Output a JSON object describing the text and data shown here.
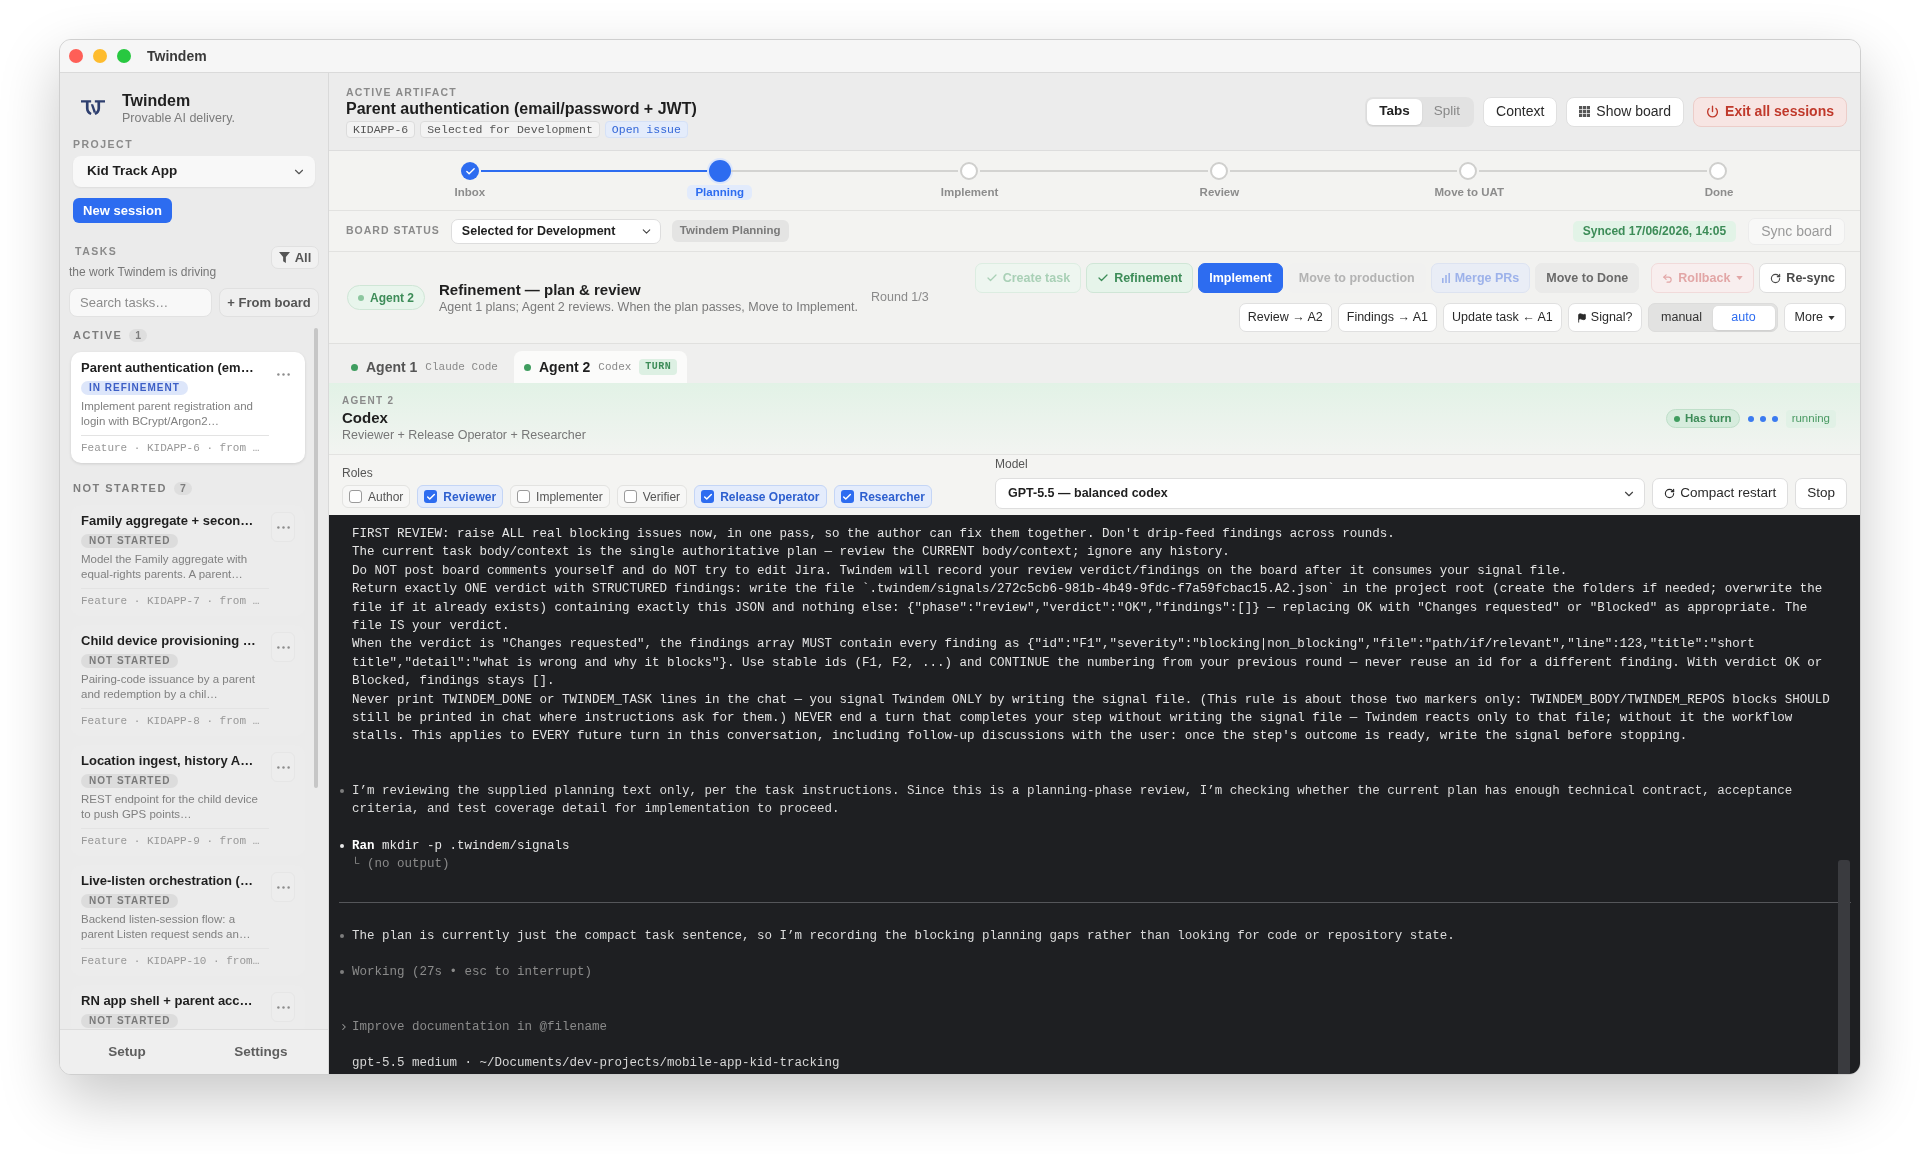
{
  "window": {
    "title": "Twindem"
  },
  "sidebar": {
    "brand": {
      "name": "Twindem",
      "tagline": "Provable AI delivery."
    },
    "project": {
      "label": "PROJECT",
      "value": "Kid Track App"
    },
    "new_session_button": "New session",
    "tasks": {
      "label": "TASKS",
      "subtitle": "the work Twindem is driving",
      "filter": "All",
      "search_placeholder": "Search tasks…",
      "from_board_button": "+ From board"
    },
    "groups": [
      {
        "label": "ACTIVE",
        "count": "1",
        "tasks": [
          {
            "title": "Parent authentication (em…",
            "status": "IN REFINEMENT",
            "kind": "refinement",
            "description": "Implement parent registration and login with BCrypt/Argon2…",
            "meta": "Feature · KIDAPP-6 · from …",
            "selected": true
          }
        ]
      },
      {
        "label": "NOT STARTED",
        "count": "7",
        "tasks": [
          {
            "title": "Family aggregate + secon…",
            "status": "NOT STARTED",
            "kind": "not_started",
            "description": "Model the Family aggregate with equal-rights parents. A parent…",
            "meta": "Feature · KIDAPP-7 · from …",
            "selected": false
          },
          {
            "title": "Child device provisioning …",
            "status": "NOT STARTED",
            "kind": "not_started",
            "description": "Pairing-code issuance by a parent and redemption by a chil…",
            "meta": "Feature · KIDAPP-8 · from …",
            "selected": false
          },
          {
            "title": "Location ingest, history A…",
            "status": "NOT STARTED",
            "kind": "not_started",
            "description": "REST endpoint for the child device to push GPS points…",
            "meta": "Feature · KIDAPP-9 · from …",
            "selected": false
          },
          {
            "title": "Live-listen orchestration (…",
            "status": "NOT STARTED",
            "kind": "not_started",
            "description": "Backend listen-session flow: a parent Listen request sends an…",
            "meta": "Feature · KIDAPP-10 · from…",
            "selected": false
          },
          {
            "title": "RN app shell + parent acc…",
            "status": "NOT STARTED",
            "kind": "not_started",
            "selected": false
          }
        ]
      }
    ],
    "footer": [
      "Setup",
      "Settings"
    ]
  },
  "artifact": {
    "label": "ACTIVE ARTIFACT",
    "title": "Parent authentication (email/password + JWT)",
    "tags": [
      {
        "text": "KIDAPP-6",
        "kind": "key"
      },
      {
        "text": "Selected for Development",
        "kind": "status"
      },
      {
        "text": "Open issue",
        "kind": "link"
      }
    ]
  },
  "view_modes": [
    {
      "label": "Tabs",
      "selected": true
    },
    {
      "label": "Split",
      "selected": false
    }
  ],
  "header_actions": [
    {
      "label": "Context",
      "kind": "plain"
    },
    {
      "label": "Show board",
      "kind": "board"
    },
    {
      "label": "Exit all sessions",
      "kind": "exit"
    }
  ],
  "stepper": [
    {
      "label": "Inbox",
      "completed": true,
      "selected": false
    },
    {
      "label": "Planning",
      "completed": false,
      "selected": true
    },
    {
      "label": "Implement",
      "completed": false,
      "selected": false
    },
    {
      "label": "Review",
      "completed": false,
      "selected": false
    },
    {
      "label": "Move to UAT",
      "completed": false,
      "selected": false
    },
    {
      "label": "Done",
      "completed": false,
      "selected": false
    }
  ],
  "board_status": {
    "label": "BOARD STATUS",
    "value": "Selected for Development",
    "tag": "Twindem Planning",
    "synced": "Synced 17/06/2026, 14:05",
    "sync_button": "Sync board"
  },
  "phase": {
    "agent": "Agent 2",
    "title": "Refinement — plan & review",
    "subtitle": "Agent 1 plans; Agent 2 reviews. When the plan passes, Move to Implement.",
    "round": "Round 1/3"
  },
  "phase_actions": [
    {
      "label": "Create task",
      "kind": "completed",
      "disabled": true
    },
    {
      "label": "Refinement",
      "kind": "completed",
      "disabled": false
    },
    {
      "label": "Implement",
      "kind": "primary",
      "disabled": false
    },
    {
      "label": "Move to production",
      "kind": "plain",
      "disabled": true
    },
    {
      "label": "Merge PRs",
      "kind": "merge",
      "disabled": true
    },
    {
      "label": "Move to Done",
      "kind": "plain",
      "disabled": false
    },
    {
      "label": "Rollback",
      "kind": "rollback",
      "disabled": true
    },
    {
      "label": "Re-sync",
      "kind": "resync",
      "disabled": false
    }
  ],
  "handoff_actions": [
    {
      "label": "Review → A2",
      "kind": "plain"
    },
    {
      "label": "Findings → A1",
      "kind": "plain"
    },
    {
      "label": "Update task ← A1",
      "kind": "plain"
    },
    {
      "label": "Signal?",
      "kind": "signal"
    }
  ],
  "mode_toggle": [
    {
      "label": "manual",
      "selected": false
    },
    {
      "label": "auto",
      "selected": true
    }
  ],
  "more_button": "More",
  "agent_tabs": [
    {
      "name": "Agent 1",
      "tool": "Claude Code",
      "selected": false
    },
    {
      "name": "Agent 2",
      "tool": "Codex",
      "badge": "TURN",
      "selected": true
    }
  ],
  "agent": {
    "label": "AGENT 2",
    "name": "Codex",
    "roles_summary": "Reviewer + Release Operator + Researcher",
    "turn_badge": "Has turn",
    "status": "running"
  },
  "roles": {
    "label": "Roles",
    "items": [
      {
        "label": "Author",
        "checked": false
      },
      {
        "label": "Reviewer",
        "checked": true
      },
      {
        "label": "Implementer",
        "checked": false
      },
      {
        "label": "Verifier",
        "checked": false
      },
      {
        "label": "Release Operator",
        "checked": true
      },
      {
        "label": "Researcher",
        "checked": true
      }
    ]
  },
  "model": {
    "label": "Model",
    "value": "GPT-5.5 — balanced codex",
    "buttons": [
      {
        "label": "Compact restart",
        "kind": "restart"
      },
      {
        "label": "Stop",
        "kind": "plain"
      }
    ]
  },
  "terminal": {
    "prompt": [
      "FIRST REVIEW: raise ALL real blocking issues now, in one pass, so the author can fix them together. Don't drip-feed findings across rounds.",
      "The current task body/context is the single authoritative plan — review the CURRENT body/context; ignore any history.",
      "Do NOT post board comments yourself and do NOT try to edit Jira. Twindem will record your review verdict/findings on the board after it consumes your signal file.",
      "Return exactly ONE verdict with STRUCTURED findings: write the file `.twindem/signals/272c5cb6-981b-4b49-9fdc-f7a59fcbac15.A2.json` in the project root (create the folders if needed; overwrite the file if it already exists) containing exactly this JSON and nothing else: {\"phase\":\"review\",\"verdict\":\"OK\",\"findings\":[]} — replacing OK with \"Changes requested\" or \"Blocked\" as appropriate. The file IS your verdict.",
      "When the verdict is \"Changes requested\", the findings array MUST contain every finding as {\"id\":\"F1\",\"severity\":\"blocking|non_blocking\",\"file\":\"path/if/relevant\",\"line\":123,\"title\":\"short title\",\"detail\":\"what is wrong and why it blocks\"}. Use stable ids (F1, F2, ...) and CONTINUE the numbering from your previous round — never reuse an id for a different finding. With verdict OK or Blocked, findings stays [].",
      "Never print TWINDEM_DONE or TWINDEM_TASK lines in the chat — you signal Twindem ONLY by writing the signal file. (This rule is about those two markers only: TWINDEM_BODY/TWINDEM_REPOS blocks SHOULD still be printed in chat where instructions ask for them.) NEVER end a turn that completes your step without writing the signal file — Twindem reacts only to that file; without it the workflow stalls. This applies to EVERY future turn in this conversation, including follow-up discussions with the user: once the step's outcome is ready, write the signal before stopping."
    ],
    "entries": [
      {
        "kind": "message",
        "text": "I’m reviewing the supplied planning text only, per the task instructions. Since this is a planning-phase review, I’m checking whether the current plan has enough technical contract, acceptance criteria, and test coverage detail for implementation to proceed."
      },
      {
        "kind": "command",
        "text": "**Ran** mkdir -p .twindem/signals",
        "output": "└ (no output)"
      },
      {
        "kind": "separator"
      },
      {
        "kind": "message",
        "text": "The plan is currently just the compact task sentence, so I’m recording the blocking planning gaps rather than looking for code or repository state."
      },
      {
        "kind": "status",
        "text": "Working (27s • esc to interrupt)"
      }
    ],
    "input_placeholder": "Improve documentation in @filename",
    "footer": "gpt-5.5 medium · ~/Documents/dev-projects/mobile-app-kid-tracking"
  }
}
